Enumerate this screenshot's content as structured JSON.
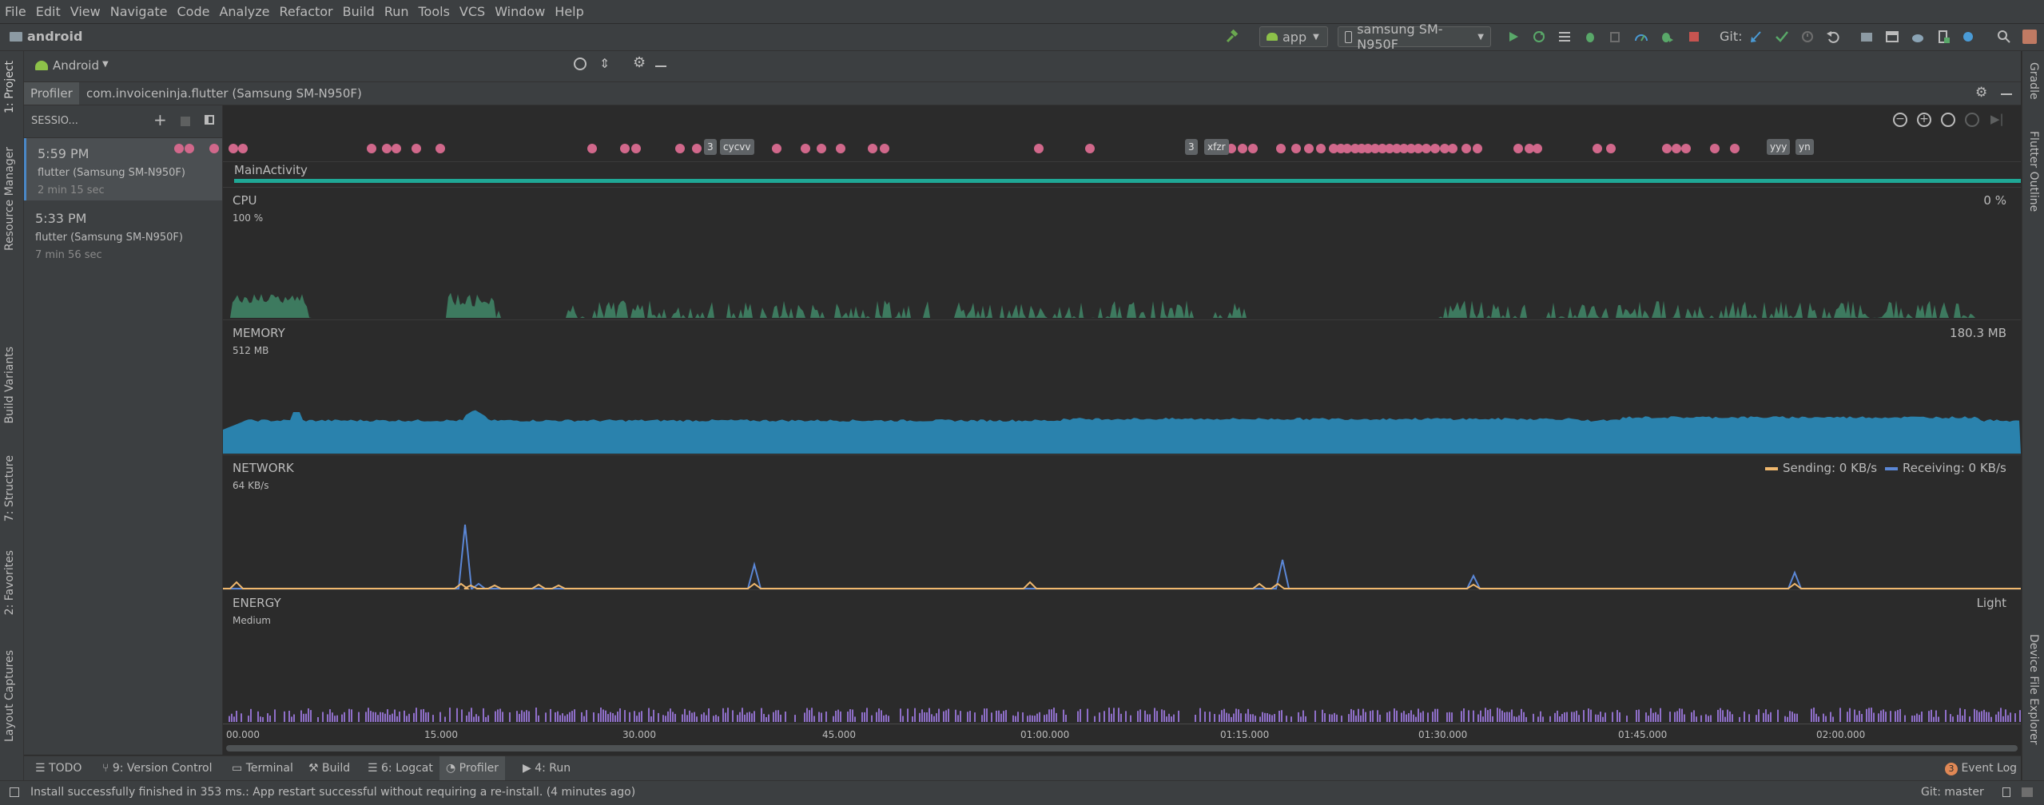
{
  "menu": [
    "File",
    "Edit",
    "View",
    "Navigate",
    "Code",
    "Analyze",
    "Refactor",
    "Build",
    "Run",
    "Tools",
    "VCS",
    "Window",
    "Help"
  ],
  "navbar": {
    "project": "android",
    "run_config": "app",
    "device": "samsung SM-N950F",
    "git_label": "Git:"
  },
  "project_panel": {
    "view_mode": "Android"
  },
  "left_tabs": [
    "1: Project",
    "Resource Manager",
    "Build Variants",
    "7: Structure",
    "2: Favorites",
    "Layout Captures"
  ],
  "right_tabs": [
    "Gradle",
    "Flutter Outline",
    "Device File Explorer"
  ],
  "profiler_tabs": {
    "profiler": "Profiler",
    "process": "com.invoiceninja.flutter (Samsung SM-N950F)"
  },
  "sessions": {
    "header": "SESSIO...",
    "items": [
      {
        "time": "5:59 PM",
        "device": "flutter (Samsung SM-N950F)",
        "length": "2 min 15 sec",
        "selected": true
      },
      {
        "time": "5:33 PM",
        "device": "flutter (Samsung SM-N950F)",
        "length": "7 min 56 sec",
        "selected": false
      }
    ]
  },
  "activity": {
    "name": "MainActivity",
    "tags": [
      "cycvv",
      "xfzr",
      "yyy",
      "yn"
    ],
    "tag_counts": [
      "3",
      "3"
    ]
  },
  "cpu": {
    "title": "CPU",
    "scale": "100 %",
    "value": "0 %",
    "color": "#3d7a5f"
  },
  "memory": {
    "title": "MEMORY",
    "scale": "512 MB",
    "value": "180.3 MB",
    "color": "#2a82ad"
  },
  "network": {
    "title": "NETWORK",
    "scale": "64 KB/s",
    "sending": "Sending: 0 KB/s",
    "receiving": "Receiving: 0 KB/s",
    "send_color": "#f0b86e",
    "recv_color": "#5b87d6"
  },
  "energy": {
    "title": "ENERGY",
    "scale": "Medium",
    "value": "Light",
    "color": "#8f6fc9"
  },
  "timeline": {
    "ticks": [
      "00.000",
      "15.000",
      "30.000",
      "45.000",
      "01:00.000",
      "01:15.000",
      "01:30.000",
      "01:45.000",
      "02:00.000"
    ]
  },
  "toolwindows": [
    "TODO",
    "9: Version Control",
    "Terminal",
    "Build",
    "6: Logcat",
    "Profiler",
    "4: Run"
  ],
  "event_log": {
    "count": "3",
    "label": "Event Log"
  },
  "status": {
    "message": "Install successfully finished in 353 ms.: App restart successful without requiring a re-install. (4 minutes ago)",
    "git": "Git: master"
  }
}
